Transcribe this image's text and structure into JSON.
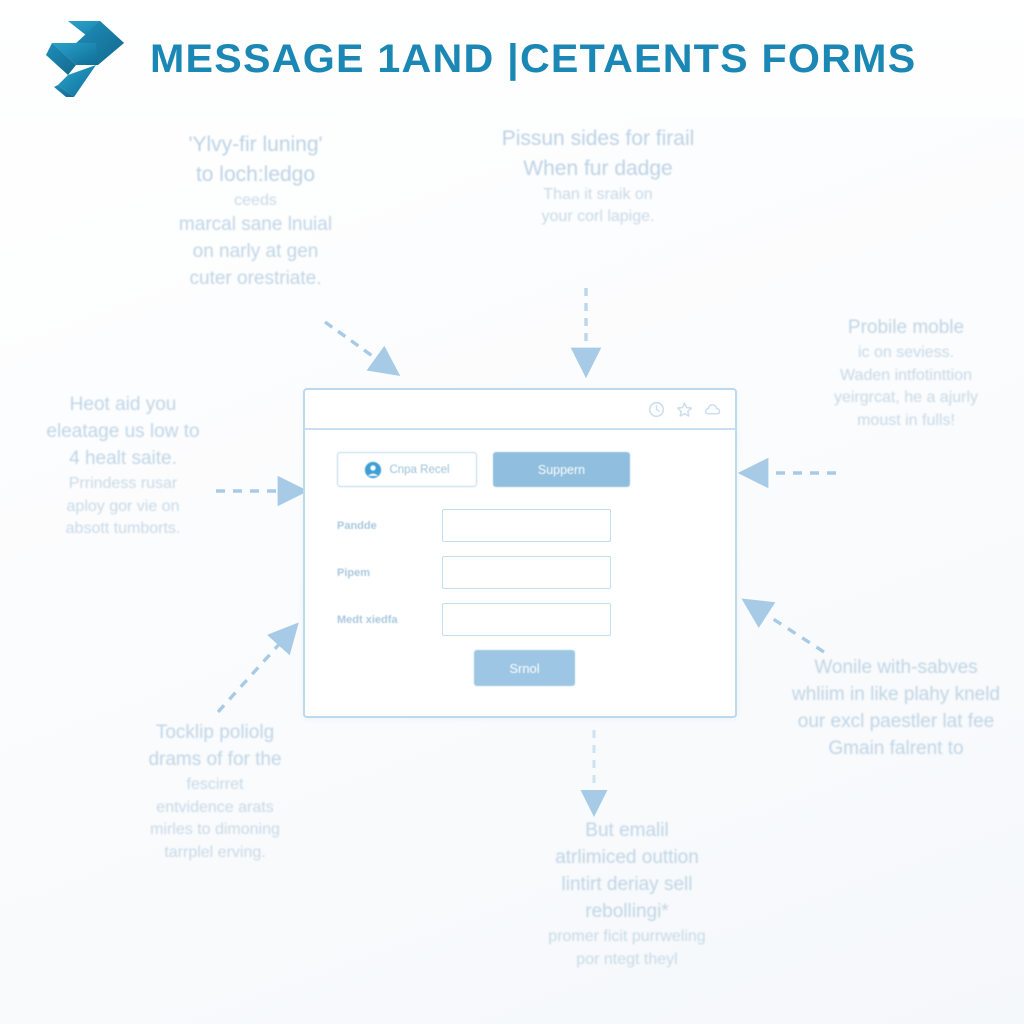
{
  "header": {
    "title": "MESSAGE 1AND |CETAENTS FORMS",
    "logo_icon": "double-chevron-logo",
    "title_color": "#1b87b4",
    "logo_color": "#1a82b0"
  },
  "theme": {
    "background": "#fbfcfd",
    "accent": "#8fbede",
    "annotation_text": "#c3d6e6",
    "border": "#bcd9ee"
  },
  "annotations": [
    {
      "id": "note-tl",
      "position": "top-left",
      "lines": [
        {
          "text": "'Ylvy-fir luning'",
          "size": "big"
        },
        {
          "text": "to loch:ledgo",
          "size": "big"
        },
        {
          "text": "ceeds",
          "size": "small"
        },
        {
          "text": "marcal sane lnuial",
          "size": "mid"
        },
        {
          "text": "on narly at gen",
          "size": "mid"
        },
        {
          "text": "cuter orestriate.",
          "size": "mid"
        }
      ]
    },
    {
      "id": "note-tc",
      "position": "top-center",
      "lines": [
        {
          "text": "Pissun sides for firail",
          "size": "big"
        },
        {
          "text": "When fur dadge",
          "size": "big"
        },
        {
          "text": "Than it sraik on",
          "size": "small"
        },
        {
          "text": "your corl lapige.",
          "size": "small"
        }
      ]
    },
    {
      "id": "note-tr",
      "position": "top-right",
      "lines": [
        {
          "text": "Probile moble",
          "size": "mid"
        },
        {
          "text": "ic on seviess.",
          "size": "small"
        },
        {
          "text": "Waden intfotinttion",
          "size": "small"
        },
        {
          "text": "yeirgrcat, he a ajurly",
          "size": "small"
        },
        {
          "text": "moust in fulls!",
          "size": "small"
        }
      ]
    },
    {
      "id": "note-ml",
      "position": "middle-left",
      "lines": [
        {
          "text": "Heot aid you",
          "size": "mid"
        },
        {
          "text": "eleatage us low to",
          "size": "mid"
        },
        {
          "text": "4 healt saite.",
          "size": "mid"
        },
        {
          "text": "Prrindess rusar",
          "size": "small"
        },
        {
          "text": "aploy gor vie on",
          "size": "small"
        },
        {
          "text": "absott tumborts.",
          "size": "small"
        }
      ]
    },
    {
      "id": "note-bl",
      "position": "bottom-left",
      "lines": [
        {
          "text": "Tocklip poliolg",
          "size": "mid"
        },
        {
          "text": "drams of for the",
          "size": "mid"
        },
        {
          "text": "fescirret",
          "size": "small"
        },
        {
          "text": "entvidence arats",
          "size": "small"
        },
        {
          "text": "mirles to dimoning",
          "size": "small"
        },
        {
          "text": "tarrplel erving.",
          "size": "small"
        }
      ]
    },
    {
      "id": "note-bc",
      "position": "bottom-center",
      "lines": [
        {
          "text": "But emalil",
          "size": "mid"
        },
        {
          "text": "atrlimiced outtion",
          "size": "mid"
        },
        {
          "text": "lintirt deriay sell",
          "size": "mid"
        },
        {
          "text": "rebollingi*",
          "size": "mid"
        },
        {
          "text": "promer ficit purrweling",
          "size": "small"
        },
        {
          "text": "por ntegt theyl",
          "size": "small"
        }
      ]
    },
    {
      "id": "note-br",
      "position": "bottom-right",
      "lines": [
        {
          "text": "Wonile with-sabves",
          "size": "mid"
        },
        {
          "text": "whliim in like plahy kneld",
          "size": "mid"
        },
        {
          "text": "our excl paestler lat fee",
          "size": "mid"
        },
        {
          "text": "Gmain falrent to",
          "size": "mid"
        }
      ]
    }
  ],
  "arrows": [
    {
      "id": "arrow-top-left",
      "direction": "down-right",
      "style": "dashed"
    },
    {
      "id": "arrow-top-center",
      "direction": "down",
      "style": "dashed"
    },
    {
      "id": "arrow-middle-left",
      "direction": "right",
      "style": "dashed"
    },
    {
      "id": "arrow-top-right",
      "direction": "left",
      "style": "dashed"
    },
    {
      "id": "arrow-bottom-left",
      "direction": "up-right",
      "style": "dashed"
    },
    {
      "id": "arrow-bottom-right",
      "direction": "up-left",
      "style": "dashed"
    },
    {
      "id": "arrow-bottom-center",
      "direction": "down",
      "style": "dashed"
    }
  ],
  "mockup": {
    "titlebar_icons": [
      "clock-icon",
      "star-icon",
      "cloud-icon"
    ],
    "compose_button": {
      "label": "Cnpa Recel",
      "icon": "user-avatar-icon"
    },
    "support_button": {
      "label": "Suppern"
    },
    "form_fields": [
      {
        "label": "Pandde",
        "value": "",
        "placeholder": ""
      },
      {
        "label": "Pipem",
        "value": "",
        "placeholder": ""
      },
      {
        "label": "Medt xiedfa",
        "value": "",
        "placeholder": ""
      }
    ],
    "submit_button": {
      "label": "Srnol"
    }
  }
}
